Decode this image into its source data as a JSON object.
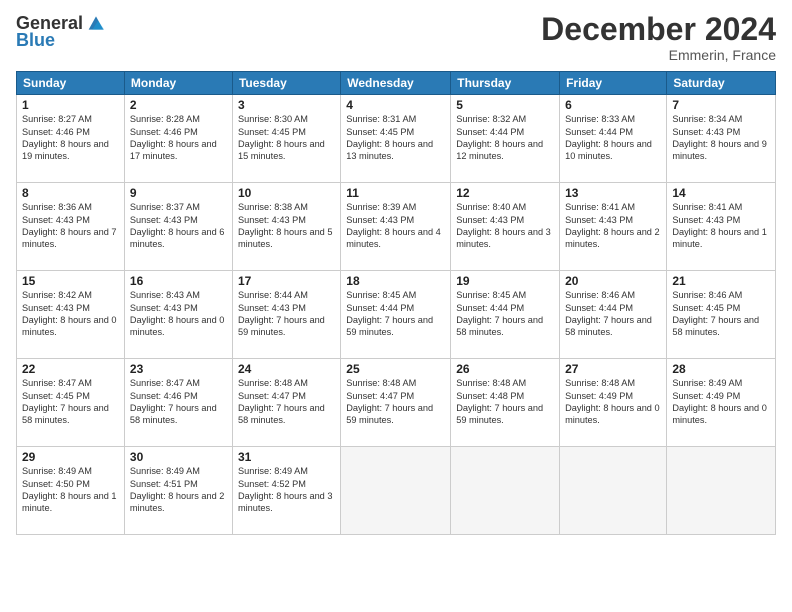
{
  "header": {
    "logo_general": "General",
    "logo_blue": "Blue",
    "month_title": "December 2024",
    "location": "Emmerin, France"
  },
  "weekdays": [
    "Sunday",
    "Monday",
    "Tuesday",
    "Wednesday",
    "Thursday",
    "Friday",
    "Saturday"
  ],
  "weeks": [
    [
      {
        "day": "1",
        "sunrise": "Sunrise: 8:27 AM",
        "sunset": "Sunset: 4:46 PM",
        "daylight": "Daylight: 8 hours and 19 minutes."
      },
      {
        "day": "2",
        "sunrise": "Sunrise: 8:28 AM",
        "sunset": "Sunset: 4:46 PM",
        "daylight": "Daylight: 8 hours and 17 minutes."
      },
      {
        "day": "3",
        "sunrise": "Sunrise: 8:30 AM",
        "sunset": "Sunset: 4:45 PM",
        "daylight": "Daylight: 8 hours and 15 minutes."
      },
      {
        "day": "4",
        "sunrise": "Sunrise: 8:31 AM",
        "sunset": "Sunset: 4:45 PM",
        "daylight": "Daylight: 8 hours and 13 minutes."
      },
      {
        "day": "5",
        "sunrise": "Sunrise: 8:32 AM",
        "sunset": "Sunset: 4:44 PM",
        "daylight": "Daylight: 8 hours and 12 minutes."
      },
      {
        "day": "6",
        "sunrise": "Sunrise: 8:33 AM",
        "sunset": "Sunset: 4:44 PM",
        "daylight": "Daylight: 8 hours and 10 minutes."
      },
      {
        "day": "7",
        "sunrise": "Sunrise: 8:34 AM",
        "sunset": "Sunset: 4:43 PM",
        "daylight": "Daylight: 8 hours and 9 minutes."
      }
    ],
    [
      {
        "day": "8",
        "sunrise": "Sunrise: 8:36 AM",
        "sunset": "Sunset: 4:43 PM",
        "daylight": "Daylight: 8 hours and 7 minutes."
      },
      {
        "day": "9",
        "sunrise": "Sunrise: 8:37 AM",
        "sunset": "Sunset: 4:43 PM",
        "daylight": "Daylight: 8 hours and 6 minutes."
      },
      {
        "day": "10",
        "sunrise": "Sunrise: 8:38 AM",
        "sunset": "Sunset: 4:43 PM",
        "daylight": "Daylight: 8 hours and 5 minutes."
      },
      {
        "day": "11",
        "sunrise": "Sunrise: 8:39 AM",
        "sunset": "Sunset: 4:43 PM",
        "daylight": "Daylight: 8 hours and 4 minutes."
      },
      {
        "day": "12",
        "sunrise": "Sunrise: 8:40 AM",
        "sunset": "Sunset: 4:43 PM",
        "daylight": "Daylight: 8 hours and 3 minutes."
      },
      {
        "day": "13",
        "sunrise": "Sunrise: 8:41 AM",
        "sunset": "Sunset: 4:43 PM",
        "daylight": "Daylight: 8 hours and 2 minutes."
      },
      {
        "day": "14",
        "sunrise": "Sunrise: 8:41 AM",
        "sunset": "Sunset: 4:43 PM",
        "daylight": "Daylight: 8 hours and 1 minute."
      }
    ],
    [
      {
        "day": "15",
        "sunrise": "Sunrise: 8:42 AM",
        "sunset": "Sunset: 4:43 PM",
        "daylight": "Daylight: 8 hours and 0 minutes."
      },
      {
        "day": "16",
        "sunrise": "Sunrise: 8:43 AM",
        "sunset": "Sunset: 4:43 PM",
        "daylight": "Daylight: 8 hours and 0 minutes."
      },
      {
        "day": "17",
        "sunrise": "Sunrise: 8:44 AM",
        "sunset": "Sunset: 4:43 PM",
        "daylight": "Daylight: 7 hours and 59 minutes."
      },
      {
        "day": "18",
        "sunrise": "Sunrise: 8:45 AM",
        "sunset": "Sunset: 4:44 PM",
        "daylight": "Daylight: 7 hours and 59 minutes."
      },
      {
        "day": "19",
        "sunrise": "Sunrise: 8:45 AM",
        "sunset": "Sunset: 4:44 PM",
        "daylight": "Daylight: 7 hours and 58 minutes."
      },
      {
        "day": "20",
        "sunrise": "Sunrise: 8:46 AM",
        "sunset": "Sunset: 4:44 PM",
        "daylight": "Daylight: 7 hours and 58 minutes."
      },
      {
        "day": "21",
        "sunrise": "Sunrise: 8:46 AM",
        "sunset": "Sunset: 4:45 PM",
        "daylight": "Daylight: 7 hours and 58 minutes."
      }
    ],
    [
      {
        "day": "22",
        "sunrise": "Sunrise: 8:47 AM",
        "sunset": "Sunset: 4:45 PM",
        "daylight": "Daylight: 7 hours and 58 minutes."
      },
      {
        "day": "23",
        "sunrise": "Sunrise: 8:47 AM",
        "sunset": "Sunset: 4:46 PM",
        "daylight": "Daylight: 7 hours and 58 minutes."
      },
      {
        "day": "24",
        "sunrise": "Sunrise: 8:48 AM",
        "sunset": "Sunset: 4:47 PM",
        "daylight": "Daylight: 7 hours and 58 minutes."
      },
      {
        "day": "25",
        "sunrise": "Sunrise: 8:48 AM",
        "sunset": "Sunset: 4:47 PM",
        "daylight": "Daylight: 7 hours and 59 minutes."
      },
      {
        "day": "26",
        "sunrise": "Sunrise: 8:48 AM",
        "sunset": "Sunset: 4:48 PM",
        "daylight": "Daylight: 7 hours and 59 minutes."
      },
      {
        "day": "27",
        "sunrise": "Sunrise: 8:48 AM",
        "sunset": "Sunset: 4:49 PM",
        "daylight": "Daylight: 8 hours and 0 minutes."
      },
      {
        "day": "28",
        "sunrise": "Sunrise: 8:49 AM",
        "sunset": "Sunset: 4:49 PM",
        "daylight": "Daylight: 8 hours and 0 minutes."
      }
    ],
    [
      {
        "day": "29",
        "sunrise": "Sunrise: 8:49 AM",
        "sunset": "Sunset: 4:50 PM",
        "daylight": "Daylight: 8 hours and 1 minute."
      },
      {
        "day": "30",
        "sunrise": "Sunrise: 8:49 AM",
        "sunset": "Sunset: 4:51 PM",
        "daylight": "Daylight: 8 hours and 2 minutes."
      },
      {
        "day": "31",
        "sunrise": "Sunrise: 8:49 AM",
        "sunset": "Sunset: 4:52 PM",
        "daylight": "Daylight: 8 hours and 3 minutes."
      },
      null,
      null,
      null,
      null
    ]
  ]
}
